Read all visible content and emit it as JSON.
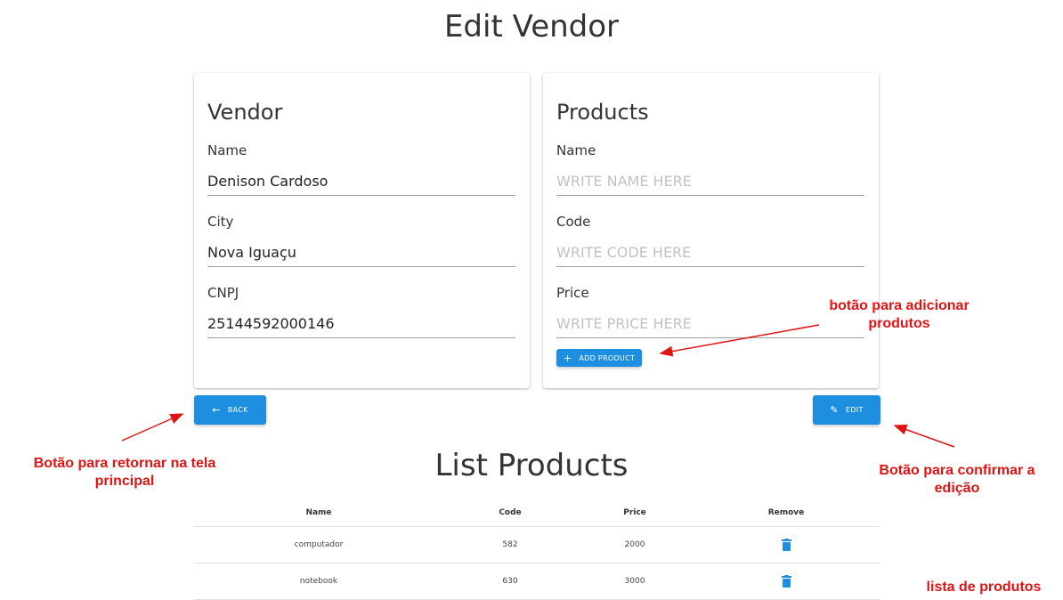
{
  "page": {
    "title": "Edit Vendor"
  },
  "vendor": {
    "heading": "Vendor",
    "name_label": "Name",
    "name_value": "Denison Cardoso",
    "city_label": "City",
    "city_value": "Nova Iguaçu",
    "cnpj_label": "CNPJ",
    "cnpj_value": "25144592000146"
  },
  "products": {
    "heading": "Products",
    "name_label": "Name",
    "name_placeholder": "WRITE NAME HERE",
    "code_label": "Code",
    "code_placeholder": "WRITE CODE HERE",
    "price_label": "Price",
    "price_placeholder": "WRITE PRICE HERE",
    "add_icon": "plus-icon",
    "add_label": "ADD PRODUCT"
  },
  "actions": {
    "back_icon": "arrow-left-icon",
    "back_label": "BACK",
    "edit_icon": "pencil-icon",
    "edit_label": "EDIT"
  },
  "list": {
    "title": "List Products",
    "headers": [
      "Name",
      "Code",
      "Price",
      "Remove"
    ],
    "rows": [
      {
        "name": "computador",
        "code": "582",
        "price": "2000",
        "remove_icon": "trash-icon"
      },
      {
        "name": "notebook",
        "code": "630",
        "price": "3000",
        "remove_icon": "trash-icon"
      }
    ]
  },
  "annotations": {
    "add_product": "botão para adicionar produtos",
    "back": "Botão para retornar na tela principal",
    "edit": "Botão para confirmar a edição",
    "list": "lista de produtos"
  },
  "colors": {
    "primary": "#1e8fe0",
    "annotation": "#e01414"
  }
}
